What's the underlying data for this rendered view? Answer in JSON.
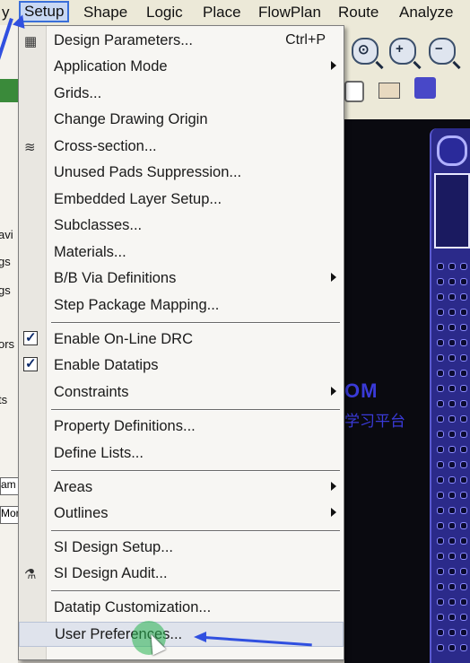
{
  "menubar": {
    "items": [
      "y",
      "Setup",
      "Shape",
      "Logic",
      "Place",
      "FlowPlan",
      "Route",
      "Analyze"
    ],
    "active": "Setup"
  },
  "left_panel": {
    "fragments": [
      "avi",
      "gs",
      "gs",
      "ors",
      "ts",
      "am",
      "Mor"
    ]
  },
  "canvas": {
    "watermark_line1": "OM",
    "watermark_line2": "学习平台"
  },
  "setup_menu": {
    "items": [
      {
        "label": "Design Parameters...",
        "shortcut": "Ctrl+P",
        "icon": "design-parameters-icon"
      },
      {
        "label": "Application Mode",
        "submenu": true
      },
      {
        "label": "Grids..."
      },
      {
        "label": "Change Drawing Origin"
      },
      {
        "label": "Cross-section...",
        "icon": "cross-section-icon"
      },
      {
        "label": "Unused Pads Suppression..."
      },
      {
        "label": "Embedded Layer Setup..."
      },
      {
        "label": "Subclasses..."
      },
      {
        "label": "Materials..."
      },
      {
        "label": "B/B Via Definitions",
        "submenu": true
      },
      {
        "label": "Step Package Mapping..."
      },
      {
        "label": "Enable On-Line DRC",
        "checked": true
      },
      {
        "label": "Enable Datatips",
        "checked": true
      },
      {
        "label": "Constraints",
        "submenu": true
      },
      {
        "label": "Property Definitions..."
      },
      {
        "label": "Define Lists..."
      },
      {
        "label": "Areas",
        "submenu": true
      },
      {
        "label": "Outlines",
        "submenu": true
      },
      {
        "label": "SI Design Setup..."
      },
      {
        "label": "SI Design Audit...",
        "icon": "si-audit-icon"
      },
      {
        "label": "Datatip Customization..."
      },
      {
        "label": "User Preferences...",
        "highlighted": true
      }
    ]
  },
  "colors": {
    "menu_bg": "#f7f6f3",
    "highlight_border": "#3a6fd8",
    "annotation_arrow": "#3050e0",
    "click_indicator": "#28b450",
    "pcb_fill": "#2b2a8a"
  }
}
